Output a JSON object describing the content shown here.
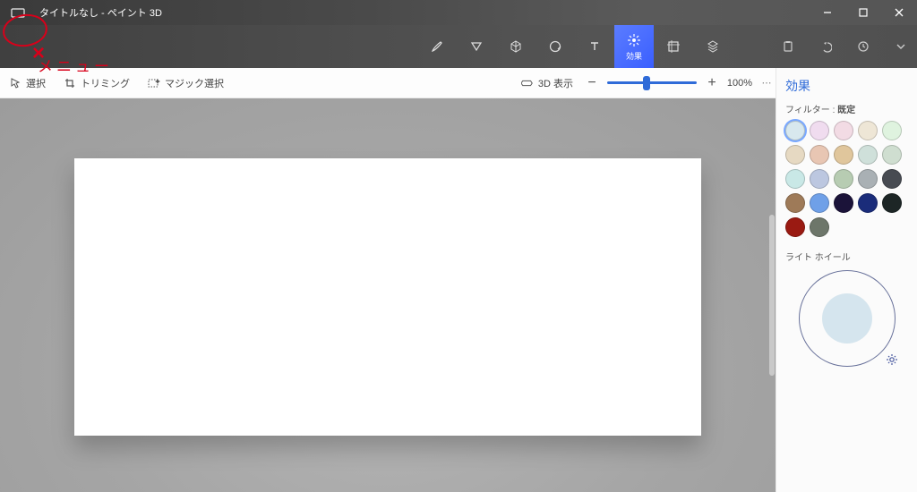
{
  "window": {
    "title": "タイトルなし - ペイント 3D"
  },
  "annotation": {
    "label": "メニュー"
  },
  "mainTabs": {
    "effects_label": "効果"
  },
  "toolbar": {
    "select": "選択",
    "trim": "トリミング",
    "magic": "マジック選択",
    "view3d": "3D 表示",
    "zoom_pct": "100%"
  },
  "sidepanel": {
    "title": "効果",
    "filter_label": "フィルター :",
    "filter_value": "既定",
    "wheel_label": "ライト ホイール",
    "swatches": [
      "#d8e8ee",
      "#f0dcef",
      "#f2dbe4",
      "#eee6d6",
      "#dff3df",
      "#e6d9c2",
      "#e8c6b3",
      "#e0c69c",
      "#cfe0da",
      "#cfded0",
      "#c9e8e6",
      "#bcc7e0",
      "#b7ccb2",
      "#a9b0b4",
      "#474b52",
      "#9e7a58",
      "#6fa0e8",
      "#1b1339",
      "#1a2c7a",
      "#1d2626",
      "#9a1a12",
      "#6d766a"
    ],
    "selected_swatch": 0
  }
}
